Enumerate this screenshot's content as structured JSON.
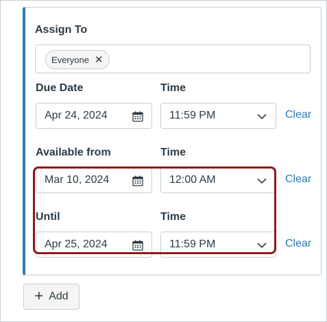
{
  "assign": {
    "heading": "Assign To",
    "chip_label": "Everyone",
    "chip_remove_glyph": "✕"
  },
  "due": {
    "date_label": "Due Date",
    "time_label": "Time",
    "date_value": "Apr 24, 2024",
    "time_value": "11:59 PM",
    "clear_label": "Clear"
  },
  "available_from": {
    "date_label": "Available from",
    "time_label": "Time",
    "date_value": "Mar 10, 2024",
    "time_value": "12:00 AM",
    "clear_label": "Clear"
  },
  "until": {
    "date_label": "Until",
    "time_label": "Time",
    "date_value": "Apr 25, 2024",
    "time_value": "11:59 PM",
    "clear_label": "Clear"
  },
  "add_button": {
    "label": "Add",
    "icon": "plus-icon"
  },
  "colors": {
    "accent": "#2b7abc",
    "highlight_border": "#8b1a1a",
    "text": "#2d3b45"
  },
  "icons": {
    "date": "calendar-icon",
    "time": "chevron-down-icon"
  }
}
